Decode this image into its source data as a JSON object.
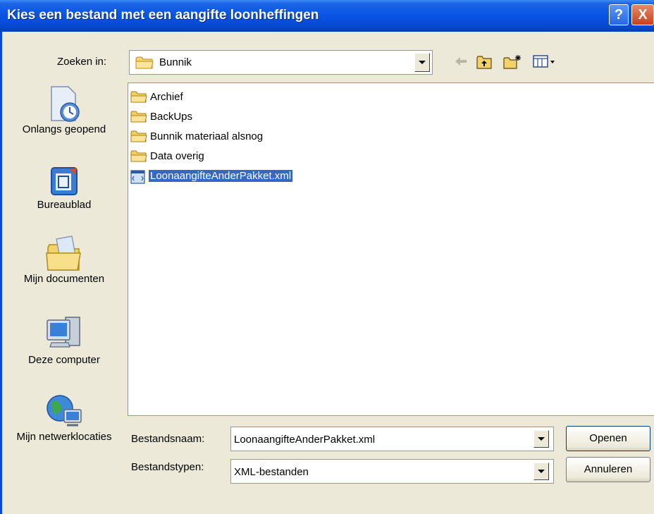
{
  "window": {
    "title": "Kies een bestand met een aangifte loonheffingen",
    "help_button": "?",
    "close_button": "X"
  },
  "lookin": {
    "label": "Zoeken in:",
    "value": "Bunnik"
  },
  "toolbar": {
    "icons": [
      "back-arrow-icon",
      "up-folder-icon",
      "new-folder-icon",
      "view-menu-icon"
    ]
  },
  "places": [
    {
      "label": "Onlangs geopend",
      "icon": "recent-documents-icon"
    },
    {
      "label": "Bureaublad",
      "icon": "desktop-icon"
    },
    {
      "label": "Mijn documenten",
      "icon": "my-documents-icon"
    },
    {
      "label": "Deze computer",
      "icon": "my-computer-icon"
    },
    {
      "label": "Mijn netwerklocaties",
      "icon": "network-places-icon"
    }
  ],
  "files": [
    {
      "name": "Archief",
      "type": "folder"
    },
    {
      "name": "BackUps",
      "type": "folder"
    },
    {
      "name": "Bunnik materiaal alsnog",
      "type": "folder"
    },
    {
      "name": "Data overig",
      "type": "folder"
    },
    {
      "name": "LoonaangifteAnderPakket.xml",
      "type": "xml",
      "selected": true
    }
  ],
  "filename": {
    "label": "Bestandsnaam:",
    "value": "LoonaangifteAnderPakket.xml"
  },
  "filetype": {
    "label": "Bestandstypen:",
    "value": "XML-bestanden"
  },
  "buttons": {
    "open": "Openen",
    "cancel": "Annuleren"
  },
  "colors": {
    "titlebar": "#0854e3",
    "selection": "#316ac5",
    "dialog_bg": "#ece9d8"
  }
}
